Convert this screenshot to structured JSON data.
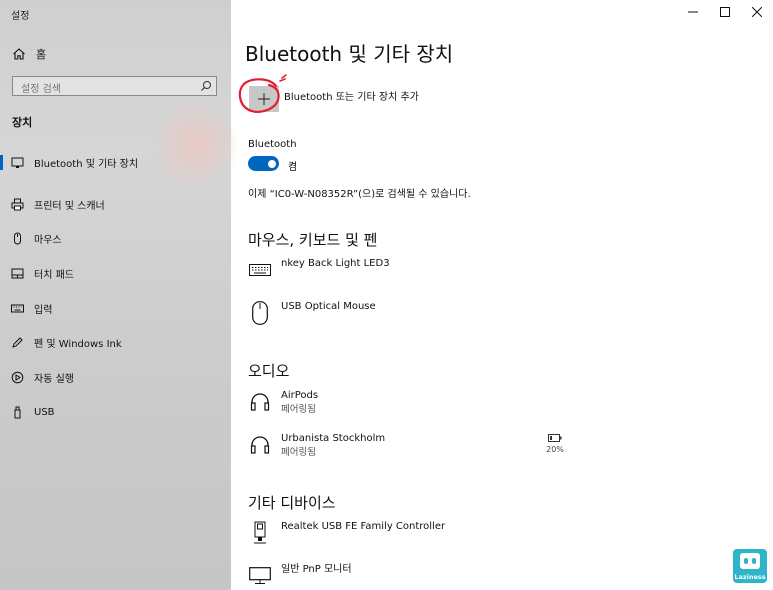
{
  "window": {
    "title": "설정",
    "controls": [
      "minimize",
      "maximize",
      "close"
    ]
  },
  "sidebar": {
    "home_label": "홈",
    "search_placeholder": "설정 검색",
    "section_label": "장치",
    "items": [
      {
        "label": "Bluetooth 및 기타 장치",
        "icon": "bluetooth-devices-icon",
        "active": true
      },
      {
        "label": "프린터 및 스캐너",
        "icon": "printer-icon"
      },
      {
        "label": "마우스",
        "icon": "mouse-icon"
      },
      {
        "label": "터치 패드",
        "icon": "touchpad-icon"
      },
      {
        "label": "입력",
        "icon": "keyboard-icon"
      },
      {
        "label": "펜 및 Windows Ink",
        "icon": "pen-icon"
      },
      {
        "label": "자동 실행",
        "icon": "autoplay-icon"
      },
      {
        "label": "USB",
        "icon": "usb-icon"
      }
    ]
  },
  "main": {
    "title": "Bluetooth 및 기타 장치",
    "add_device_label": "Bluetooth 또는 기타 장치 추가",
    "bluetooth_label": "Bluetooth",
    "bluetooth_state": "켬",
    "discoverable_text": "이제 “IC0-W-N08352R”(으)로 검색될 수 있습니다.",
    "categories": {
      "input": "마우스, 키보드 및 펜",
      "audio": "오디오",
      "other": "기타 디바이스"
    },
    "input_devices": [
      {
        "name": "nkey Back Light LED3",
        "icon": "keyboard-icon"
      },
      {
        "name": "USB Optical Mouse",
        "icon": "mouse-icon"
      }
    ],
    "audio_devices": [
      {
        "name": "AirPods",
        "status": "페어링됨",
        "icon": "headphones-icon"
      },
      {
        "name": "Urbanista Stockholm",
        "status": "페어링됨",
        "icon": "headphones-icon",
        "battery": "20%"
      }
    ],
    "other_devices": [
      {
        "name": "Realtek USB FE Family Controller",
        "icon": "network-adapter-icon"
      },
      {
        "name": "일반 PnP 모니터",
        "icon": "monitor-icon"
      }
    ]
  },
  "watermark": {
    "text": "Laziness"
  },
  "colors": {
    "accent": "#0067c0",
    "annotation": "#e0202e",
    "logo": "#2fb5c9"
  }
}
